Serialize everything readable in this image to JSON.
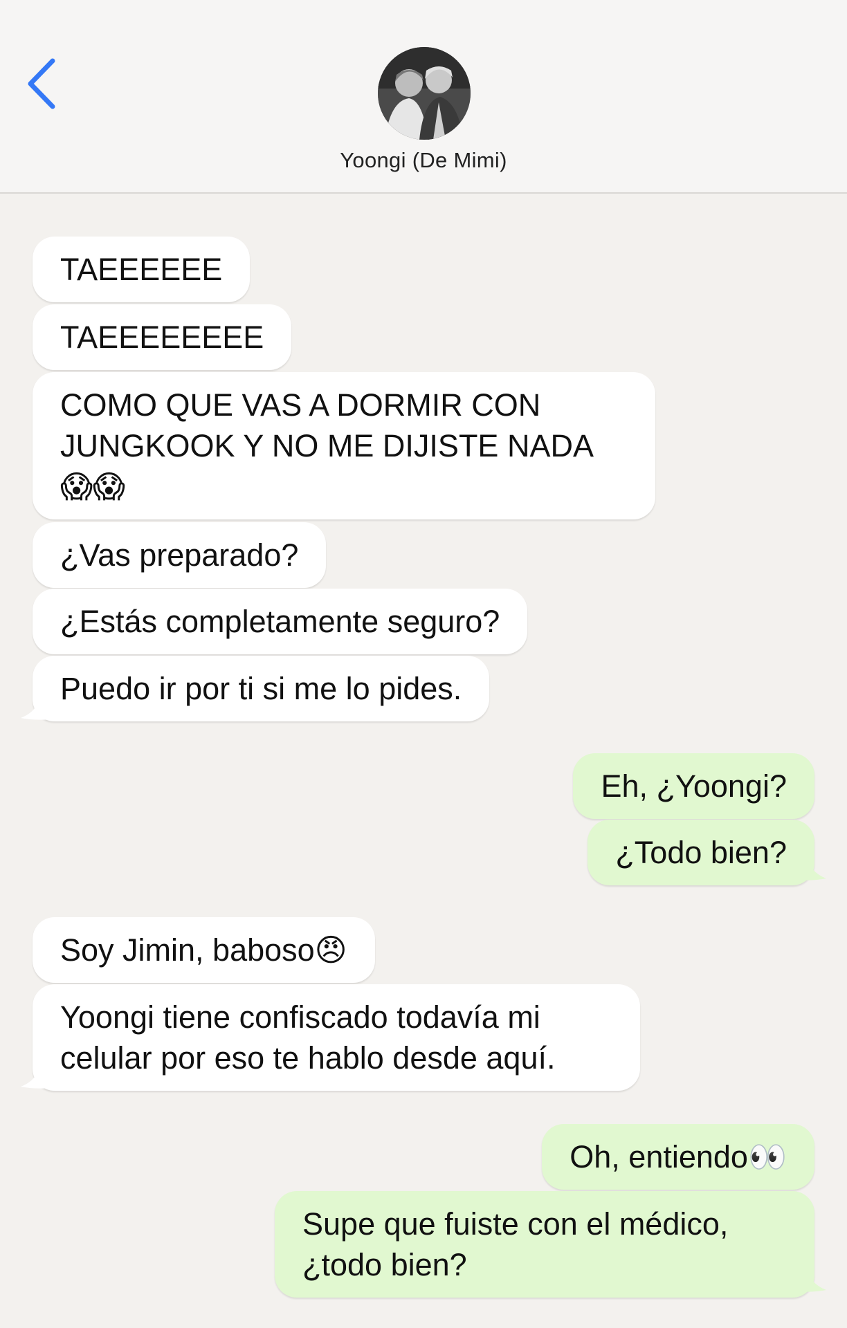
{
  "header": {
    "contact_name": "Yoongi (De Mimi)",
    "back_icon": "chevron-left-icon",
    "accent_color": "#3478f6"
  },
  "messages": [
    {
      "side": "in",
      "text": "TAEEEEEE"
    },
    {
      "side": "in",
      "text": "TAEEEEEEEE"
    },
    {
      "side": "in",
      "line1": "COMO QUE VAS A DORMIR CON",
      "line2": "JUNGKOOK Y NO ME DIJISTE NADA",
      "line3": "😱😱"
    },
    {
      "side": "in",
      "text": "¿Vas preparado?"
    },
    {
      "side": "in",
      "text": "¿Estás completamente seguro?"
    },
    {
      "side": "in",
      "text": "Puedo ir por ti si me lo pides."
    },
    {
      "side": "out",
      "text": "Eh, ¿Yoongi?"
    },
    {
      "side": "out",
      "text": "¿Todo bien?"
    },
    {
      "side": "in",
      "text": "Soy Jimin, baboso😠"
    },
    {
      "side": "in",
      "line1": "Yoongi tiene confiscado todavía mi",
      "line2": "celular por eso te hablo desde aquí."
    },
    {
      "side": "out",
      "text": "Oh, entiendo👀"
    },
    {
      "side": "out",
      "line1": "Supe que fuiste con el médico,",
      "line2": "¿todo bien?"
    }
  ],
  "colors": {
    "incoming_bubble": "#ffffff",
    "outgoing_bubble": "#e1f8d0",
    "background": "#f3f1ee"
  }
}
